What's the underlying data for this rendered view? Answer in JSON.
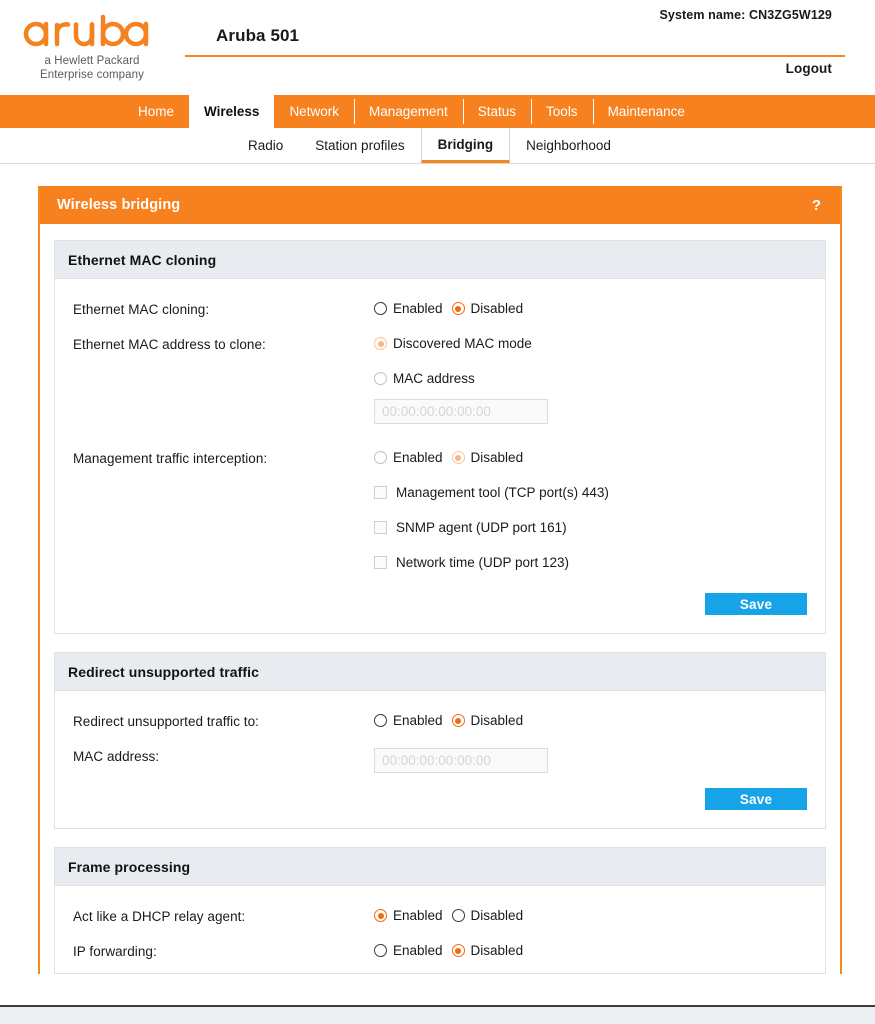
{
  "header": {
    "logo_text": "aruba",
    "logo_tagline_line1": "a Hewlett Packard",
    "logo_tagline_line2": "Enterprise company",
    "product_title": "Aruba 501",
    "system_name": "System name: CN3ZG5W129",
    "logout_label": "Logout"
  },
  "main_nav": {
    "items": [
      {
        "label": "Home",
        "active": false
      },
      {
        "label": "Wireless",
        "active": true
      },
      {
        "label": "Network",
        "active": false
      },
      {
        "label": "Management",
        "active": false
      },
      {
        "label": "Status",
        "active": false
      },
      {
        "label": "Tools",
        "active": false
      },
      {
        "label": "Maintenance",
        "active": false
      }
    ]
  },
  "sub_nav": {
    "items": [
      {
        "label": "Radio",
        "active": false
      },
      {
        "label": "Station profiles",
        "active": false
      },
      {
        "label": "Bridging",
        "active": true
      },
      {
        "label": "Neighborhood",
        "active": false
      }
    ]
  },
  "panel": {
    "title": "Wireless bridging",
    "help_icon_label": "?"
  },
  "sections": {
    "mac_cloning": {
      "title": "Ethernet MAC cloning",
      "rows": {
        "cloning": {
          "label": "Ethernet MAC cloning:",
          "enabled_label": "Enabled",
          "disabled_label": "Disabled",
          "selected": "Disabled"
        },
        "address_to_clone": {
          "label": "Ethernet MAC address to clone:",
          "option_discovered": "Discovered MAC mode",
          "option_mac_address": "MAC address",
          "selected": "Discovered MAC mode",
          "mac_placeholder": "00:00:00:00:00:00",
          "mac_value": ""
        },
        "interception": {
          "label": "Management traffic interception:",
          "enabled_label": "Enabled",
          "disabled_label": "Disabled",
          "selected": "Disabled",
          "checkboxes": [
            {
              "label": "Management tool (TCP port(s)  443)",
              "checked": false
            },
            {
              "label": "SNMP agent (UDP port 161)",
              "checked": false
            },
            {
              "label": "Network time (UDP port 123)",
              "checked": false
            }
          ]
        }
      },
      "save_label": "Save"
    },
    "redirect": {
      "title": "Redirect unsupported traffic",
      "rows": {
        "redirect_to": {
          "label": "Redirect unsupported traffic to:",
          "enabled_label": "Enabled",
          "disabled_label": "Disabled",
          "selected": "Disabled"
        },
        "mac_address": {
          "label": "MAC address:",
          "placeholder": "00:00:00:00:00:00",
          "value": ""
        }
      },
      "save_label": "Save"
    },
    "frame_processing": {
      "title": "Frame processing",
      "rows": {
        "dhcp_relay": {
          "label": "Act like a DHCP relay agent:",
          "enabled_label": "Enabled",
          "disabled_label": "Disabled",
          "selected": "Enabled"
        },
        "ip_forwarding": {
          "label": "IP forwarding:",
          "enabled_label": "Enabled",
          "disabled_label": "Disabled",
          "selected": "Disabled"
        }
      }
    }
  },
  "colors": {
    "brand_orange": "#f8811f",
    "accent_orange": "#f26b0f",
    "save_blue": "#17a3e8",
    "section_head": "#e8ecf0"
  }
}
